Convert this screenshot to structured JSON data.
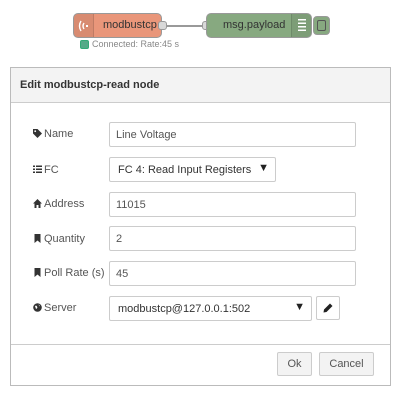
{
  "flow": {
    "source_node": {
      "label": "modbustcp",
      "icon": "modbus-signal-icon",
      "color": "#e9967a"
    },
    "debug_node": {
      "label": "msg.payload",
      "icon": "debug-list-icon",
      "color": "#87a980"
    },
    "status_text": "Connected: Rate:45 s"
  },
  "dialog": {
    "title": "Edit modbustcp-read node",
    "fields": {
      "name": {
        "label": "Name",
        "icon": "tag-icon",
        "value": "Line Voltage"
      },
      "fc": {
        "label": "FC",
        "icon": "list-icon",
        "value": "FC 4: Read Input Registers"
      },
      "address": {
        "label": "Address",
        "icon": "home-icon",
        "value": "11015"
      },
      "quantity": {
        "label": "Quantity",
        "icon": "bookmark-icon",
        "value": "2"
      },
      "poll_rate": {
        "label": "Poll Rate (s)",
        "icon": "bookmark-icon",
        "value": "45"
      },
      "server": {
        "label": "Server",
        "icon": "globe-icon",
        "value": "modbustcp@127.0.0.1:502",
        "edit_icon": "pencil-icon"
      }
    },
    "buttons": {
      "ok": "Ok",
      "cancel": "Cancel"
    }
  }
}
